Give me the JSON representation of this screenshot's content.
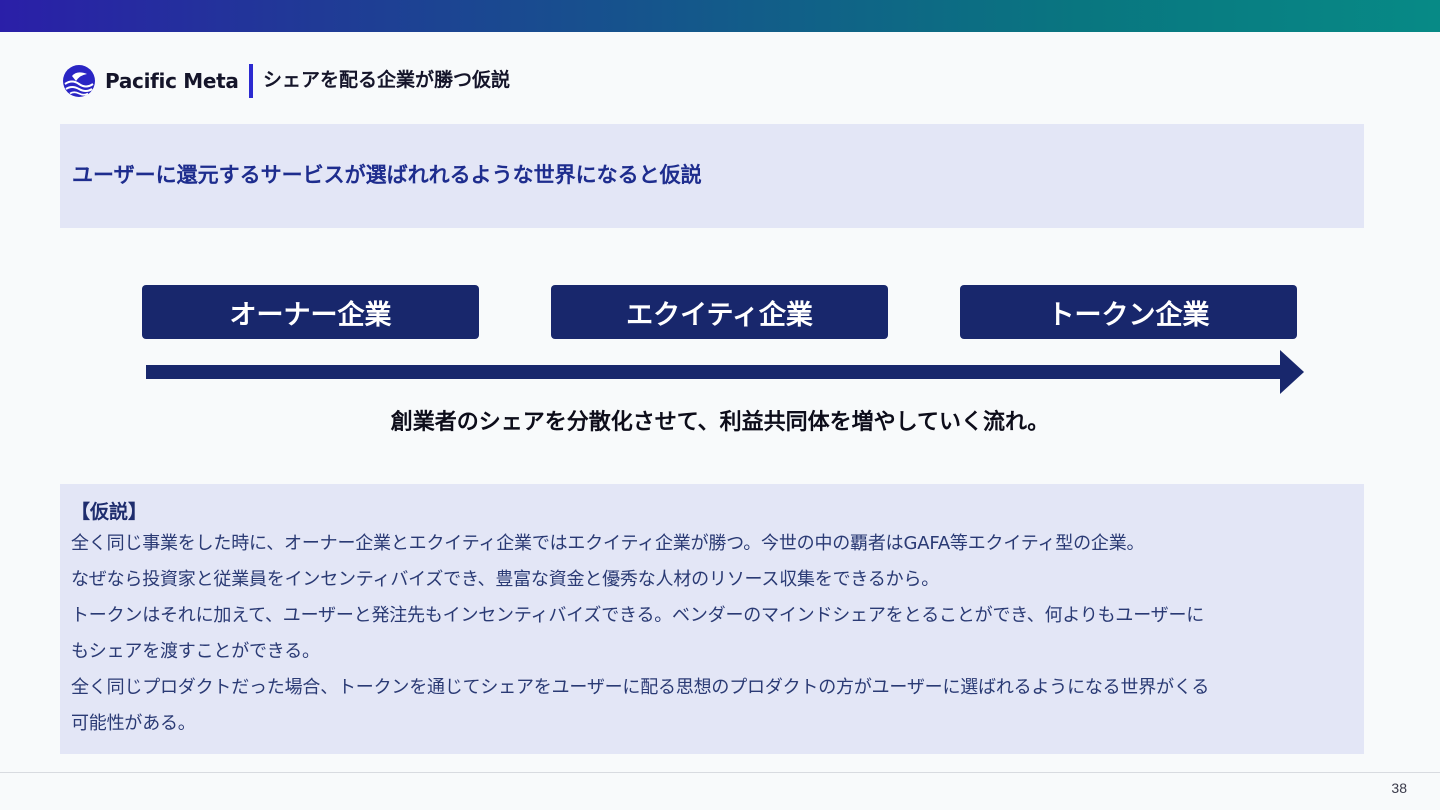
{
  "header": {
    "brand_name": "Pacific Meta",
    "page_title": "シェアを配る企業が勝つ仮説"
  },
  "hypothesis_banner": {
    "text": "ユーザーに還元するサービスが選ばれれるような世界になると仮説"
  },
  "stages": [
    {
      "label": "オーナー企業"
    },
    {
      "label": "エクイティ企業"
    },
    {
      "label": "トークン企業"
    }
  ],
  "flow_caption": "創業者のシェアを分散化させて、利益共同体を増やしていく流れ。",
  "detail": {
    "heading": "【仮説】",
    "lines": [
      "全く同じ事業をした時に、オーナー企業とエクイティ企業ではエクイティ企業が勝つ。今世の中の覇者はGAFA等エクイティ型の企業。",
      "なぜなら投資家と従業員をインセンティバイズでき、豊富な資金と優秀な人材のリソース収集をできるから。",
      "トークンはそれに加えて、ユーザーと発注先もインセンティバイズできる。ベンダーのマインドシェアをとることができ、何よりもユーザーに",
      "もシェアを渡すことができる。",
      "全く同じプロダクトだった場合、トークンを通じてシェアをユーザーに配る思想のプロダクトの方がユーザーに選ばれるようになる世界がくる",
      "可能性がある。"
    ]
  },
  "page_number": "38",
  "colors": {
    "accent": "#2c2ad0",
    "stage_fill": "#18276c",
    "banner_bg": "#e3e6f6",
    "banner_text": "#1e2d8e"
  },
  "icons": {
    "brand_logo": "pacific-meta-logo",
    "flow_arrow": "arrow-right-icon"
  }
}
